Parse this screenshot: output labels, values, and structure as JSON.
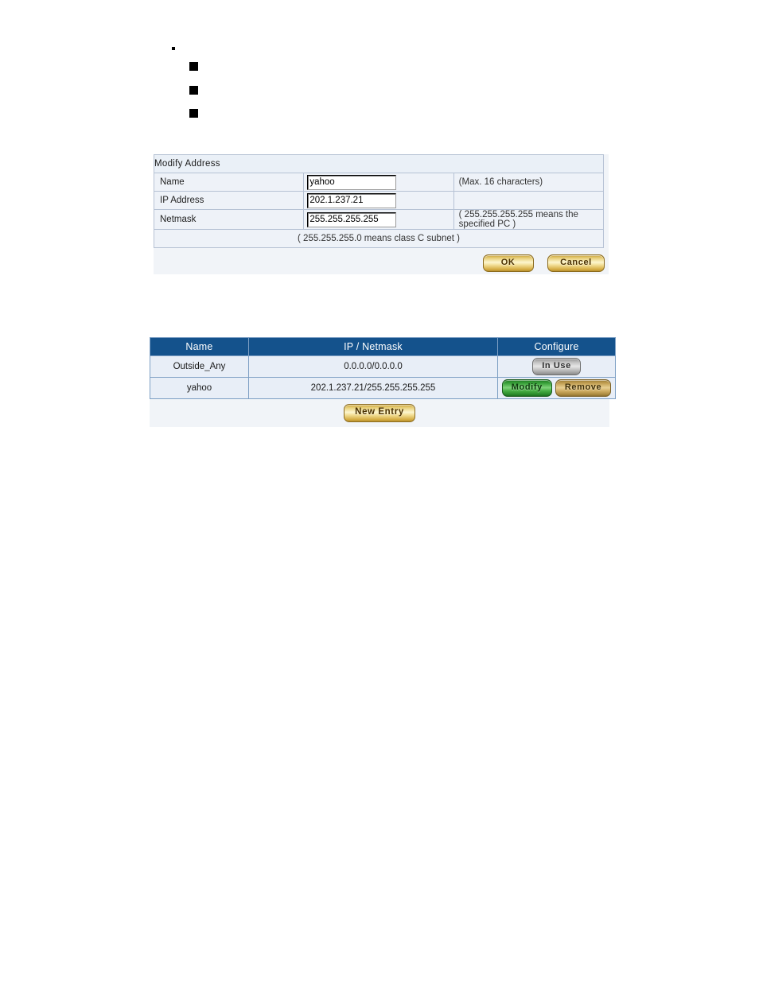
{
  "bullets": {
    "level1_count": 1,
    "level2_count": 3,
    "marker_level1": "small-square-bullet",
    "marker_level2": "filled-square-bullet"
  },
  "modify_address_form": {
    "title": "Modify Address",
    "fields": [
      {
        "label": "Name",
        "value": "yahoo",
        "hint": "(Max. 16 characters)"
      },
      {
        "label": "IP Address",
        "value": "202.1.237.21",
        "hint": ""
      },
      {
        "label": "Netmask",
        "value": "255.255.255.255",
        "hint": "( 255.255.255.255 means the specified PC )"
      }
    ],
    "extra_hint": "( 255.255.255.0 means class C subnet )",
    "buttons": {
      "ok": "OK",
      "cancel": "Cancel"
    }
  },
  "address_list": {
    "columns": [
      "Name",
      "IP / Netmask",
      "Configure"
    ],
    "rows": [
      {
        "name": "Outside_Any",
        "ip_netmask": "0.0.0.0/0.0.0.0",
        "actions": [
          {
            "label": "In Use",
            "style": "gray"
          }
        ]
      },
      {
        "name": "yahoo",
        "ip_netmask": "202.1.237.21/255.255.255.255",
        "actions": [
          {
            "label": "Modify",
            "style": "green"
          },
          {
            "label": "Remove",
            "style": "tan"
          }
        ]
      }
    ],
    "new_entry_label": "New Entry"
  },
  "colors": {
    "header_blue": "#14528c",
    "form_title_blue": "#17457e",
    "row_bg": "#e8eef7",
    "panel_bg": "#f1f4f8",
    "grid_border": "#7d9fc4",
    "gold": "#f2dd93",
    "green": "#46ad44",
    "tan": "#cfae64",
    "gray": "#c9c9c9"
  }
}
